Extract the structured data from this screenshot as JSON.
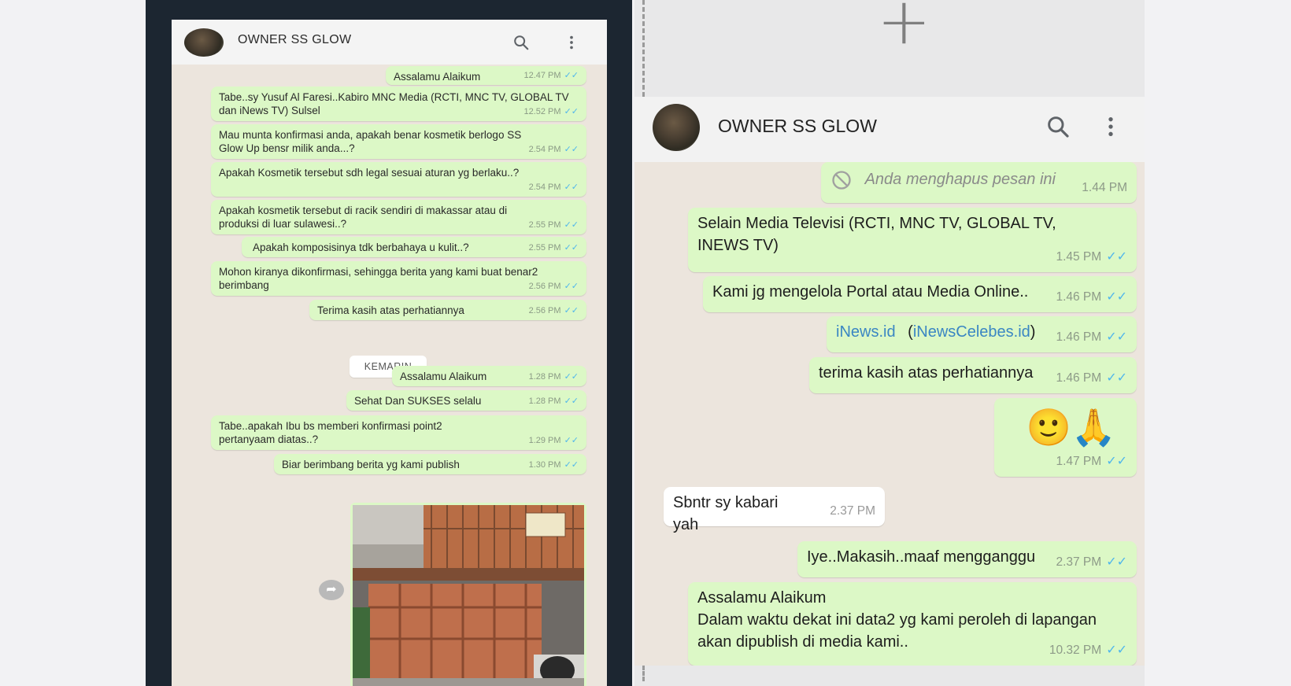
{
  "left_chat": {
    "contact_name": "OWNER SS GLOW",
    "messages": [
      {
        "text": "Assalamu Alaikum",
        "time": "12.47 PM"
      },
      {
        "text": "Tabe..sy Yusuf Al Faresi..Kabiro MNC Media (RCTI, MNC TV, GLOBAL TV dan iNews TV) Sulsel",
        "time": "12.52 PM"
      },
      {
        "text": "Mau munta konfirmasi anda, apakah benar kosmetik berlogo SS Glow Up bensr milik anda...?",
        "time": "2.54 PM"
      },
      {
        "text": "Apakah Kosmetik tersebut sdh legal sesuai aturan yg berlaku..?",
        "time": "2.54 PM"
      },
      {
        "text": "Apakah kosmetik tersebut di racik sendiri di makassar atau di produksi di luar sulawesi..?",
        "time": "2.55 PM"
      },
      {
        "text": "Apakah komposisinya tdk berbahaya u kulit..?",
        "time": "2.55 PM"
      },
      {
        "text": "Mohon kiranya dikonfirmasi, sehingga berita yang kami buat benar2 berimbang",
        "time": "2.56 PM"
      },
      {
        "text": "Terima kasih atas perhatiannya",
        "time": "2.56 PM"
      },
      {
        "text": "Assalamu Alaikum",
        "time": "1.28 PM"
      },
      {
        "text": "Sehat Dan SUKSES selalu",
        "time": "1.28 PM"
      },
      {
        "text": "Tabe..apakah Ibu bs memberi konfirmasi point2 pertanyaam diatas..?",
        "time": "1.29 PM"
      },
      {
        "text": "Biar berimbang berita yg kami publish",
        "time": "1.30 PM"
      }
    ],
    "date_divider": "KEMARIN",
    "check_mark": "✓✓"
  },
  "right_chat": {
    "contact_name": "OWNER SS GLOW",
    "add_symbol": "+",
    "messages": [
      {
        "text": "Anda menghapus pesan ini",
        "time": "1.44 PM"
      },
      {
        "text": "Selain Media Televisi  (RCTI, MNC TV, GLOBAL TV, INEWS TV)",
        "time": "1.45 PM"
      },
      {
        "text": "Kami jg mengelola Portal atau Media Online..",
        "time": "1.46 PM"
      },
      {
        "link1": "iNews.id",
        "paren_open": "(",
        "link2": "iNewsCelebes.id",
        "paren_close": ")",
        "time": "1.46 PM"
      },
      {
        "text": "terima kasih atas perhatiannya",
        "time": "1.46 PM"
      },
      {
        "text": "🙂🙏",
        "time": "1.47 PM"
      },
      {
        "text": "Sbntr sy kabari yah",
        "time": "2.37 PM"
      },
      {
        "text": "Iye..Makasih..maaf mengganggu",
        "time": "2.37 PM"
      },
      {
        "line1": "Assalamu Alaikum",
        "line2": "Dalam waktu dekat ini data2 yg kami peroleh di lapangan akan dipublish di media kami..",
        "time": "10.32 PM"
      }
    ],
    "check_mark": "✓✓"
  },
  "colors": {
    "outgoing_bubble": "#dcf8c6",
    "incoming_bubble": "#ffffff",
    "chat_background": "#ece5dd",
    "read_check": "#4fb6ec",
    "left_frame": "#1c2631"
  },
  "icons": [
    "search-icon",
    "more-vert-icon",
    "forward-icon",
    "deleted-icon",
    "add-icon"
  ]
}
